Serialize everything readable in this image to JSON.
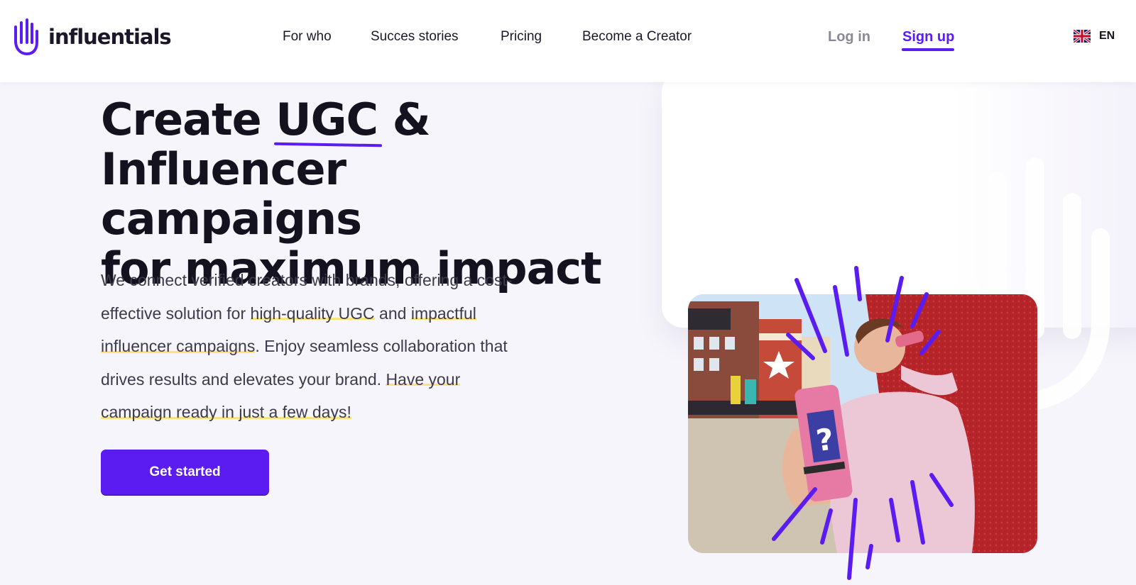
{
  "brand": {
    "name": "influentials",
    "accent": "#5b1cf1"
  },
  "nav": {
    "items": [
      {
        "label": "For who"
      },
      {
        "label": "Succes stories"
      },
      {
        "label": "Pricing"
      },
      {
        "label": "Become a Creator"
      }
    ],
    "login": "Log in",
    "signup": "Sign up",
    "language": {
      "code": "EN",
      "icon": "uk-flag-icon"
    }
  },
  "hero": {
    "headline_part1": "Create ",
    "headline_highlight": "UGC",
    "headline_part2": " &",
    "headline_line2": "Influencer campaigns",
    "headline_line3": "for maximum impact",
    "p1": "We connect verified creators with brands, offering a cost-effective solution for ",
    "p_mark1": "high-quality UGC",
    "p2": " and ",
    "p_mark2": "impactful influencer campaigns",
    "p3": ". Enjoy seamless collaboration that drives results and elevates your brand. ",
    "p_mark3": "Have your campaign ready in just a few days!",
    "cta": "Get started",
    "image": "creator-drinking-can-photo"
  },
  "colors": {
    "accent": "#5b1cf1",
    "highlight": "#fbe27d",
    "text": "#15121f",
    "background": "#f6f5fb"
  }
}
